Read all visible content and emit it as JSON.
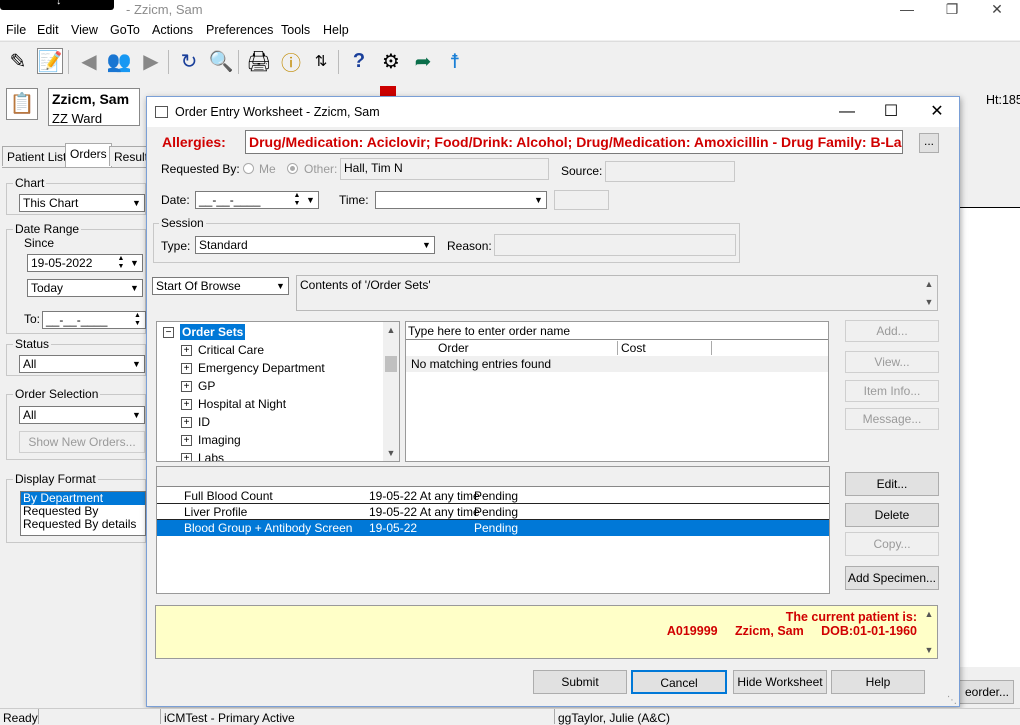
{
  "app": {
    "title": "- Zzicm, Sam",
    "titlebar_badge": "↓"
  },
  "menu": [
    "File",
    "Edit",
    "View",
    "GoTo",
    "Actions",
    "Preferences",
    "Tools",
    "Help"
  ],
  "patient": {
    "name": "Zzicm, Sam",
    "ward": "ZZ Ward",
    "right_label": "Ht:185"
  },
  "left_panel": {
    "tabs": [
      "Patient List",
      "Orders",
      "Results"
    ],
    "chart_label": "Chart",
    "chart_value": "This Chart",
    "date_range_label": "Date Range",
    "since_label": "Since",
    "since_value": "19-05-2022",
    "since_preset": "Today",
    "to_label": "To:",
    "to_value": "__-__-____",
    "status_label": "Status",
    "status_value": "All",
    "order_selection_label": "Order Selection",
    "order_selection_value": "All",
    "show_new_orders": "Show New Orders...",
    "display_format_label": "Display Format",
    "display_format_options": [
      "By Department",
      "Requested By",
      "Requested By details"
    ],
    "reorder_button": "eorder..."
  },
  "dialog": {
    "title": "Order Entry Worksheet - Zzicm, Sam",
    "allergies_label": "Allergies:",
    "allergies_text": "Drug/Medication: Aciclovir; Food/Drink: Alcohol; Drug/Medication: Amoxicillin - Drug Family: B-Lact...",
    "allergies_more": "...",
    "requested_by_label": "Requested By:",
    "me_label": "Me",
    "other_label": "Other:",
    "requested_by_value": "Hall, Tim N",
    "source_label": "Source:",
    "source_value": "",
    "date_label": "Date:",
    "date_value": "__-__-____",
    "time_label": "Time:",
    "time_value": "",
    "session_label": "Session",
    "type_label": "Type:",
    "type_value": "Standard",
    "reason_label": "Reason:",
    "reason_value": "",
    "browse_value": "Start Of Browse",
    "contents_text": "Contents of '/Order Sets'",
    "tree": {
      "root": "Order Sets",
      "items": [
        "Critical Care",
        "Emergency Department",
        "GP",
        "Hospital at Night",
        "ID",
        "Imaging",
        "Labs"
      ]
    },
    "search_placeholder": "Type here to enter order name",
    "order_columns": [
      "Order",
      "Cost"
    ],
    "no_match": "No matching entries found",
    "pending": [
      {
        "order": "Full Blood Count",
        "when": "19-05-22 At any time",
        "status": "Pending",
        "selected": false
      },
      {
        "order": "Liver Profile",
        "when": "19-05-22 At any time",
        "status": "Pending",
        "selected": false
      },
      {
        "order": "Blood Group + Antibody Screen",
        "when": "19-05-22",
        "status": "Pending",
        "selected": true
      }
    ],
    "side_buttons": {
      "add": "Add...",
      "view": "View...",
      "item_info": "Item Info...",
      "message": "Message...",
      "edit": "Edit...",
      "delete": "Delete",
      "copy": "Copy...",
      "add_specimen": "Add Specimen..."
    },
    "current_patient_line1": "The current patient is:",
    "current_patient_line2": "A019999     Zzicm, Sam     DOB:01-01-1960",
    "bottom_buttons": {
      "submit": "Submit",
      "cancel": "Cancel",
      "hide_worksheet": "Hide Worksheet",
      "help": "Help"
    }
  },
  "statusbar": {
    "ready": "Ready",
    "env": "iCMTest - Primary Active",
    "user": "ggTaylor, Julie  (A&C)"
  },
  "colors": {
    "allergy_red": "#d00000",
    "selection_blue": "#0078d7",
    "patient_note_bg": "#ffffc8"
  }
}
